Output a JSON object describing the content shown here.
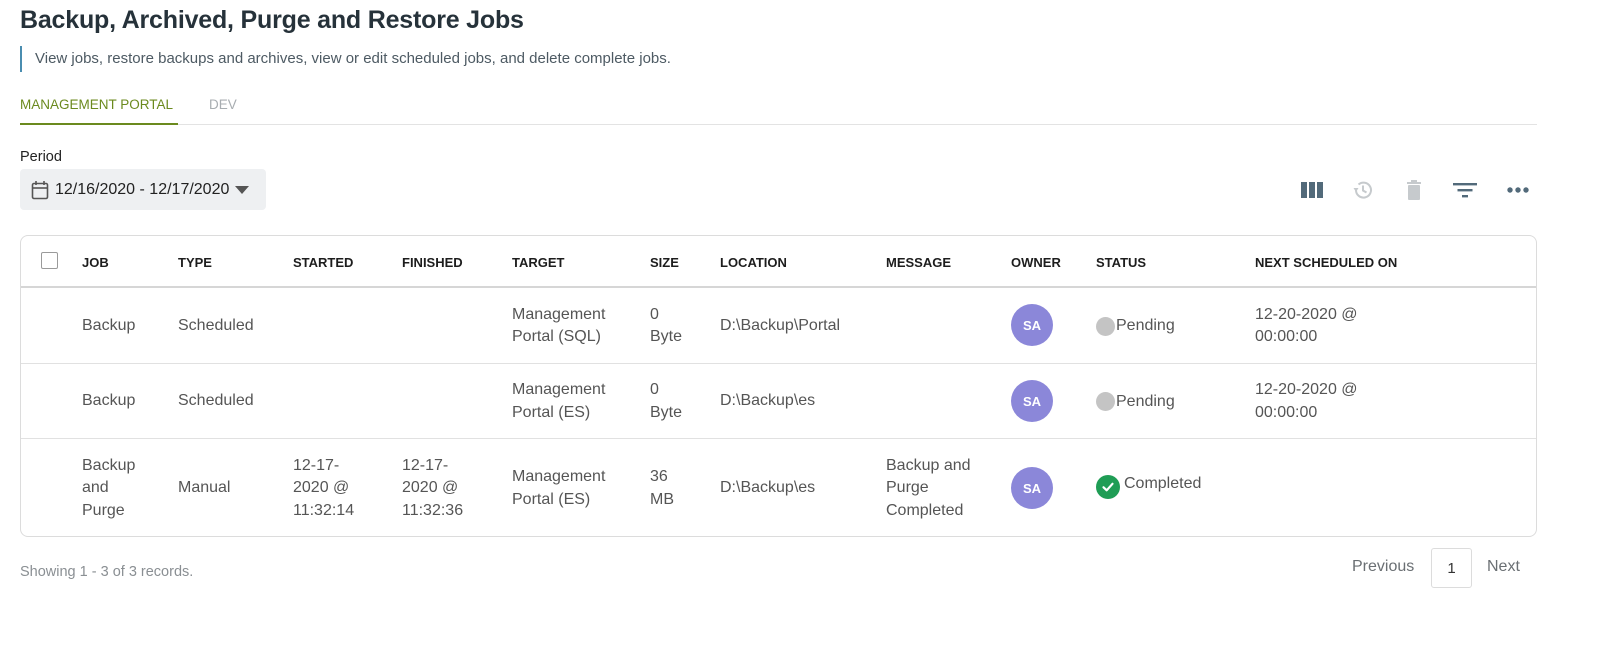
{
  "page": {
    "title": "Backup, Archived, Purge and Restore Jobs",
    "subtitle": "View jobs, restore backups and archives, view or edit scheduled jobs, and delete complete jobs."
  },
  "tabs": [
    {
      "label": "MANAGEMENT PORTAL",
      "active": true
    },
    {
      "label": "DEV",
      "active": false
    }
  ],
  "period": {
    "label": "Period",
    "range": "12/16/2020 - 12/17/2020",
    "icon": "calendar-icon"
  },
  "toolbar": {
    "icons": [
      "columns-icon",
      "history-icon",
      "delete-icon",
      "filter-icon",
      "more-icon"
    ]
  },
  "table": {
    "columns": [
      "JOB",
      "TYPE",
      "STARTED",
      "FINISHED",
      "TARGET",
      "SIZE",
      "LOCATION",
      "MESSAGE",
      "OWNER",
      "STATUS",
      "NEXT SCHEDULED ON"
    ],
    "rows": [
      {
        "job": "Backup",
        "type": "Scheduled",
        "started": "",
        "finished": "",
        "target": "Management Portal (SQL)",
        "size": "0 Byte",
        "location": "D:\\Backup\\Portal",
        "message": "",
        "owner": "SA",
        "status": "Pending",
        "next": "12-20-2020 @ 00:00:00"
      },
      {
        "job": "Backup",
        "type": "Scheduled",
        "started": "",
        "finished": "",
        "target": "Management Portal (ES)",
        "size": "0 Byte",
        "location": "D:\\Backup\\es",
        "message": "",
        "owner": "SA",
        "status": "Pending",
        "next": "12-20-2020 @ 00:00:00"
      },
      {
        "job": "Backup and Purge",
        "type": "Manual",
        "started": "12-17-2020 @ 11:32:14",
        "finished": "12-17-2020 @ 11:32:36",
        "target": "Management Portal (ES)",
        "size": "36 MB",
        "location": "D:\\Backup\\es",
        "message": "Backup and Purge Completed",
        "owner": "SA",
        "status": "Completed",
        "next": ""
      }
    ]
  },
  "footer": {
    "records_text": "Showing 1 - 3 of 3 records.",
    "previous_label": "Previous",
    "page": "1",
    "next_label": "Next"
  },
  "colors": {
    "accent": "#6b8a1e",
    "avatar": "#8b87d9",
    "completed": "#1f9d55",
    "pending": "#c4c4c4"
  }
}
